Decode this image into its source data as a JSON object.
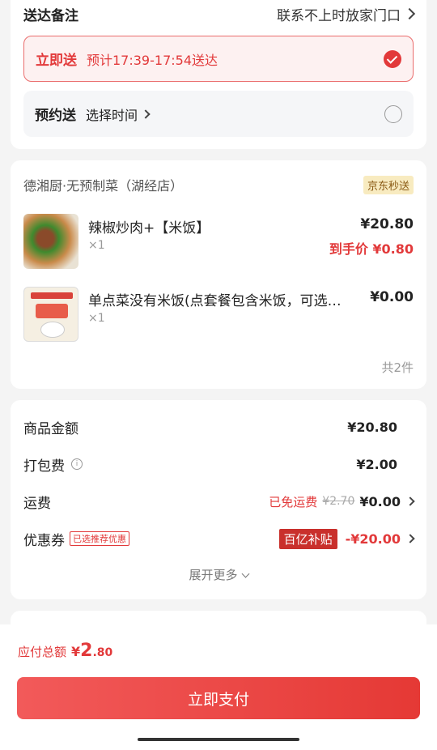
{
  "delivery": {
    "remark_label": "送达备注",
    "remark_value": "联系不上时放家门口",
    "now": {
      "label": "立即送",
      "estimate": "预计17:39-17:54送达",
      "selected": true
    },
    "scheduled": {
      "label": "预约送",
      "choose_text": "选择时间",
      "selected": false
    }
  },
  "store": {
    "name": "德湘厨·无预制菜（湖经店）",
    "badge": "京东秒送",
    "items": [
      {
        "name": "辣椒炒肉+【米饭】",
        "qty": "×1",
        "price": "¥20.80",
        "promo_label": "到手价 ¥0.80"
      },
      {
        "name": "单点菜没有米饭(点套餐包含米饭，可选…",
        "qty": "×1",
        "price": "¥0.00"
      }
    ],
    "total_count": "共2件"
  },
  "amounts": {
    "goods": {
      "label": "商品金额",
      "value": "¥20.80"
    },
    "packing": {
      "label": "打包费",
      "value": "¥2.00"
    },
    "shipping": {
      "label": "运费",
      "free_text": "已免运费",
      "original": "¥2.70",
      "value": "¥0.00"
    },
    "coupon": {
      "label": "优惠券",
      "tag": "已选推荐优惠",
      "subsidy": "百亿补贴",
      "value": "-¥20.00"
    },
    "expand": "展开更多"
  },
  "footer": {
    "payable_label": "应付总额",
    "currency": "¥",
    "amount_int": "2",
    "amount_dec": ".80",
    "pay_button": "立即支付"
  },
  "colors": {
    "accent": "#e2393a"
  }
}
